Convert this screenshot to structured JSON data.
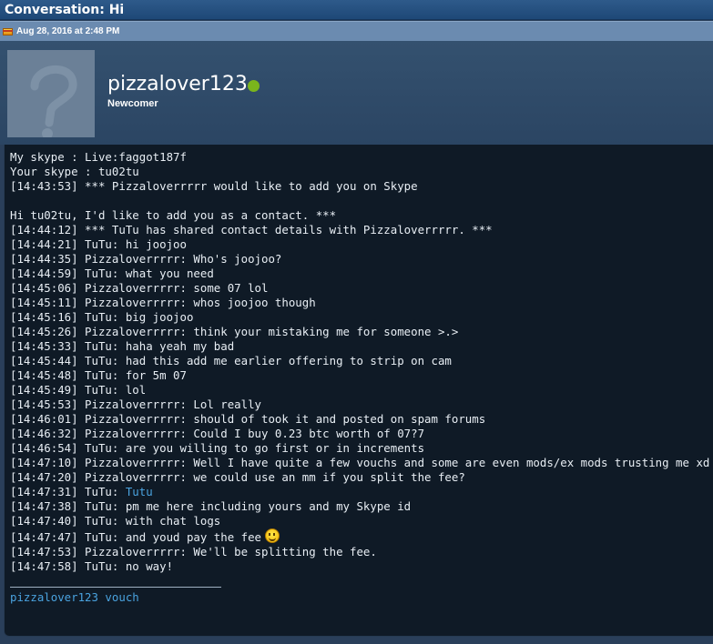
{
  "window": {
    "title": "Conversation: Hi"
  },
  "post": {
    "date": "Aug 28, 2016 at 2:48 PM"
  },
  "user": {
    "name": "pizzalover123",
    "rank": "Newcomer",
    "online_color": "#7ab51c"
  },
  "message": {
    "lines": [
      "My skype : Live:faggot187f",
      "Your skype : tu02tu",
      "[14:43:53] *** Pizzaloverrrrr would like to add you on Skype",
      "",
      "Hi tu02tu, I'd like to add you as a contact. ***",
      "[14:44:12] *** TuTu has shared contact details with Pizzaloverrrrr. ***",
      "[14:44:21] TuTu: hi joojoo",
      "[14:44:35] Pizzaloverrrrr: Who's joojoo?",
      "[14:44:59] TuTu: what you need",
      "[14:45:06] Pizzaloverrrrr: some 07 lol",
      "[14:45:11] Pizzaloverrrrr: whos joojoo though",
      "[14:45:16] TuTu: big joojoo",
      "[14:45:26] Pizzaloverrrrr: think your mistaking me for someone >.>",
      "[14:45:33] TuTu: haha yeah my bad",
      "[14:45:44] TuTu: had this add me earlier offering to strip on cam",
      "[14:45:48] TuTu: for 5m 07",
      "[14:45:49] TuTu: lol",
      "[14:45:53] Pizzaloverrrrr: Lol really",
      "[14:46:01] Pizzaloverrrrr: should of took it and posted on spam forums",
      "[14:46:32] Pizzaloverrrrr: Could I buy 0.23 btc worth of 07?7",
      "[14:46:54] TuTu: are you willing to go first or in increments",
      "[14:47:10] Pizzaloverrrrr: Well I have quite a few vouchs and some are even mods/ex mods trusting me xd",
      "[14:47:20] Pizzaloverrrrr: we could use an mm if you split the fee?"
    ],
    "link_line": {
      "prefix": "[14:47:31] TuTu: ",
      "link": "Tutu"
    },
    "lines2": [
      "[14:47:38] TuTu: pm me here including yours and my Skype id",
      "[14:47:40] TuTu: with chat logs"
    ],
    "smiley_line": "[14:47:47] TuTu: and youd pay the fee",
    "lines3": [
      "[14:47:53] Pizzaloverrrrr: We'll be splitting the fee.",
      "[14:47:58] TuTu: no way!"
    ]
  },
  "signature": {
    "text": "pizzalover123 vouch"
  }
}
